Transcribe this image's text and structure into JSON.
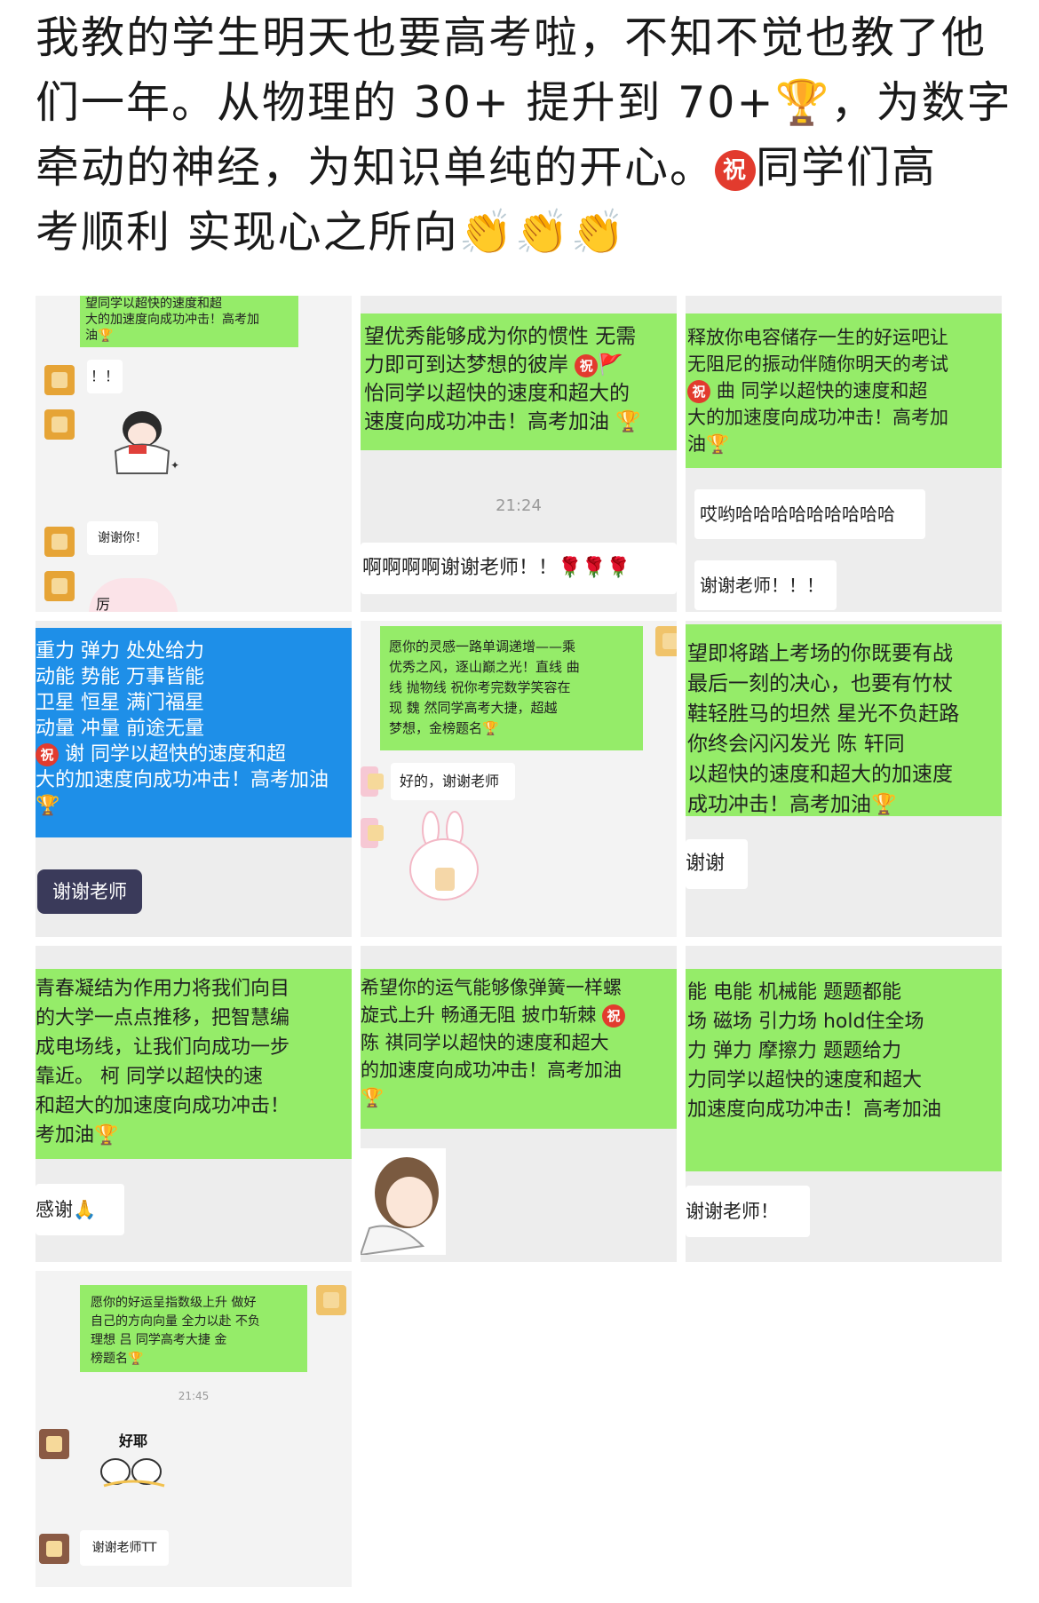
{
  "post": {
    "lines": [
      "我教的学生明天也要高考啦，不知不觉也教了他",
      "们一年。从物理的 30+ 提升到 70+",
      "，为数字",
      "牵动的神经，为知识单纯的开心。",
      "同学们高",
      "考顺利 实现心之所向"
    ],
    "trophy": "🏆",
    "zhu": "祝",
    "clap": "👏👏👏"
  },
  "cells": {
    "c1": {
      "top_lines": [
        "望同学以超快的速度和超",
        "大的加速度向成功冲击！高考加",
        "油🏆"
      ],
      "msg1": "！！",
      "msg2": "谢谢你！",
      "msg3": "厉"
    },
    "c2": {
      "lines": [
        "望优秀能够成为你的惯性 无需",
        "力即可到达梦想的彼岸",
        "怡同学以超快的速度和超大的",
        "速度向成功冲击！高考加油"
      ],
      "time": "21:24",
      "reply": "啊啊啊啊谢谢老师！！🌹🌹🌹"
    },
    "c3": {
      "lines": [
        "释放你电容储存一生的好运吧让",
        "无阻尼的振动伴随你明天的考试",
        "曲  同学以超快的速度和超",
        "大的加速度向成功冲击！高考加",
        "油🏆"
      ],
      "reply1": "哎哟哈哈哈哈哈哈哈哈哈",
      "reply2": "谢谢老师！！！"
    },
    "c4": {
      "lines": [
        "重力 弹力 处处给力",
        "动能 势能 万事皆能",
        "卫星 恒星 满门福星",
        "动量 冲量 前途无量",
        "谢  同学以超快的速度和超",
        "大的加速度向成功冲击！高考加油",
        "🏆"
      ],
      "reply": "谢谢老师"
    },
    "c5": {
      "lines": [
        "愿你的灵感一路单调递增——乘",
        "优秀之风，逐山巅之光！直线 曲",
        "线 抛物线 祝你考完数学笑容在",
        "现  魏  然同学高考大捷，超越",
        "梦想，金榜题名🏆"
      ],
      "reply": "好的，谢谢老师"
    },
    "c6": {
      "lines": [
        "望即将踏上考场的你既要有战",
        "最后一刻的决心，也要有竹杖",
        "鞋轻胜马的坦然 星光不负赶路",
        "  你终会闪闪发光  陈  轩同",
        "以超快的速度和超大的加速度",
        "成功冲击！高考加油🏆"
      ],
      "reply": "谢谢"
    },
    "c7": {
      "lines": [
        "青春凝结为作用力将我们向目",
        "的大学一点点推移，把智慧编",
        "成电场线，让我们向成功一步",
        "靠近。  柯  同学以超快的速",
        "和超大的加速度向成功冲击！",
        "考加油🏆"
      ],
      "reply": "感谢🙏"
    },
    "c8": {
      "lines": [
        "希望你的运气能够像弹簧一样螺",
        "旋式上升 畅通无阻 披巾斩棘",
        "陈  祺同学以超快的速度和超大",
        "的加速度向成功冲击！高考加油",
        "🏆"
      ]
    },
    "c9": {
      "lines": [
        "能 电能 机械能 题题都能",
        "场 磁场 引力场 hold住全场",
        "力 弹力 摩擦力 题题给力",
        "  力同学以超快的速度和超大",
        "加速度向成功冲击！高考加油"
      ],
      "reply": "谢谢老师！"
    },
    "c10": {
      "lines": [
        "愿你的好运呈指数级上升 做好",
        "自己的方向向量 全力以赴 不负",
        "理想  吕  同学高考大捷 金",
        "榜题名🏆"
      ],
      "time": "21:45",
      "sticker_text": "好耶",
      "reply": "谢谢老师TT"
    }
  },
  "colors": {
    "wechat_green": "#95ec69",
    "chat_bg": "#ededed",
    "blue_bubble": "#1e8fe8",
    "zhu_red": "#e23b2e"
  }
}
